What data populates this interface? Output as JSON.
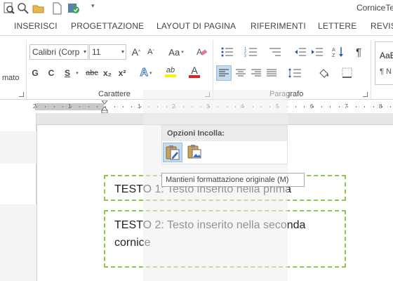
{
  "window": {
    "title": "CorniceTe"
  },
  "tabs": [
    {
      "label": "INSERISCI"
    },
    {
      "label": "PROGETTAZIONE"
    },
    {
      "label": "LAYOUT DI PAGINA"
    },
    {
      "label": "RIFERIMENTI"
    },
    {
      "label": "LETTERE"
    },
    {
      "label": "REVISI"
    }
  ],
  "ribbon": {
    "clipboard_fragment": "mato",
    "font": {
      "name": "Calibri (Corp",
      "size": "11",
      "group_label": "Carattere",
      "bold": "G",
      "italic": "C",
      "underline": "S",
      "strike": "abc",
      "subscript": "x₂",
      "superscript": "x²",
      "grow": "A",
      "shrink": "A",
      "change_case": "Aa",
      "effects": "A",
      "font_color_letter": "A",
      "highlight_letters": "ab"
    },
    "paragraph": {
      "group_label": "Paragrafo",
      "pilcrow": "¶"
    },
    "styles": {
      "preview": "AaB",
      "normal": "¶ N"
    }
  },
  "ruler": {
    "numbers": [
      "2",
      "1",
      "1",
      "2",
      "3",
      "4",
      "5",
      "6",
      "7",
      "8",
      "9",
      "10",
      "11",
      "12"
    ]
  },
  "document": {
    "frame1_text": "TESTO 1: Testo inserito nella prima",
    "frame2_line1": "TESTO 2: Testo inserito nella seconda",
    "frame2_line2": "cornice"
  },
  "paste_options": {
    "header": "Opzioni Incolla:",
    "tooltip": "Mantieni formattazione originale (M)"
  },
  "colors": {
    "frame_border": "#8cc84b",
    "selected_button": "#c5dcf0",
    "font_color_bar": "#e02020",
    "highlight_bar": "#ffee00"
  }
}
